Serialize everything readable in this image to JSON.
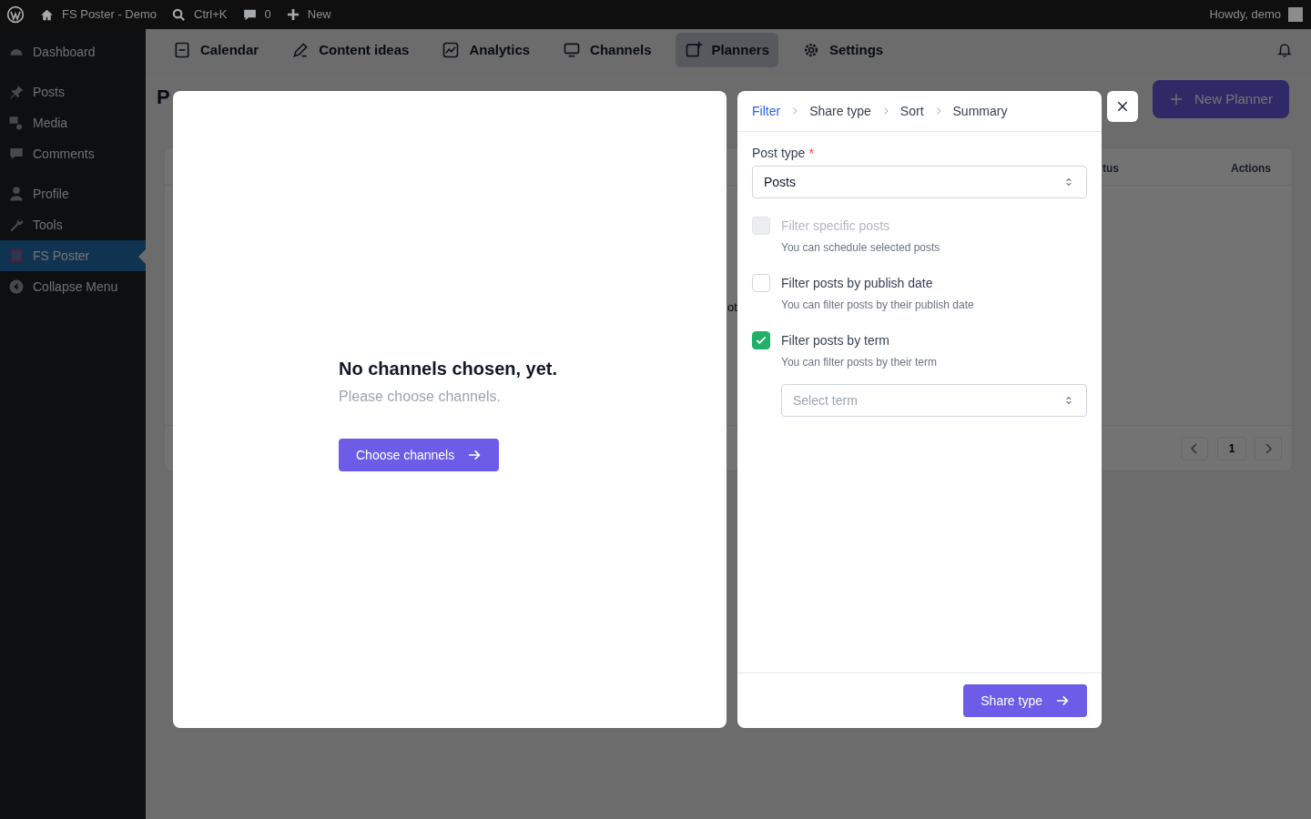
{
  "admin_bar": {
    "site": "FS Poster - Demo",
    "search": "Ctrl+K",
    "comments": "0",
    "new": "New",
    "greeting": "Howdy, demo"
  },
  "sidebar": {
    "items": [
      {
        "label": "Dashboard",
        "selected": false
      },
      {
        "label": "Posts",
        "selected": false
      },
      {
        "label": "Media",
        "selected": false
      },
      {
        "label": "Comments",
        "selected": false
      },
      {
        "label": "Profile",
        "selected": false
      },
      {
        "label": "Tools",
        "selected": false
      },
      {
        "label": "FS Poster",
        "selected": true
      },
      {
        "label": "Collapse Menu",
        "selected": false
      }
    ]
  },
  "plugin_nav": {
    "tabs": [
      {
        "label": "Calendar",
        "selected": false
      },
      {
        "label": "Content ideas",
        "selected": false
      },
      {
        "label": "Analytics",
        "selected": false
      },
      {
        "label": "Channels",
        "selected": false
      },
      {
        "label": "Planners",
        "selected": true
      },
      {
        "label": "Settings",
        "selected": false
      }
    ]
  },
  "page": {
    "heading": "P",
    "new_button": "New Planner",
    "columns": [
      "tus",
      "Actions"
    ],
    "cell": "ot",
    "current_page": "1"
  },
  "channels_panel": {
    "title": "No channels chosen, yet.",
    "subtitle": "Please choose channels.",
    "button": "Choose channels"
  },
  "wizard": {
    "steps": [
      {
        "label": "Filter",
        "selected": true
      },
      {
        "label": "Share type",
        "selected": false
      },
      {
        "label": "Sort",
        "selected": false
      },
      {
        "label": "Summary",
        "selected": false
      }
    ],
    "post_type": {
      "label": "Post type",
      "required": "*",
      "value": "Posts"
    },
    "options": [
      {
        "label": "Filter specific posts",
        "hint": "You can schedule selected posts",
        "checked": false,
        "disabled": true
      },
      {
        "label": "Filter posts by publish date",
        "hint": "You can filter posts by their publish date",
        "checked": false,
        "disabled": false
      },
      {
        "label": "Filter posts by term",
        "hint": "You can filter posts by their term",
        "checked": true,
        "disabled": false,
        "select_placeholder": "Select term"
      }
    ],
    "next_button": "Share type"
  }
}
